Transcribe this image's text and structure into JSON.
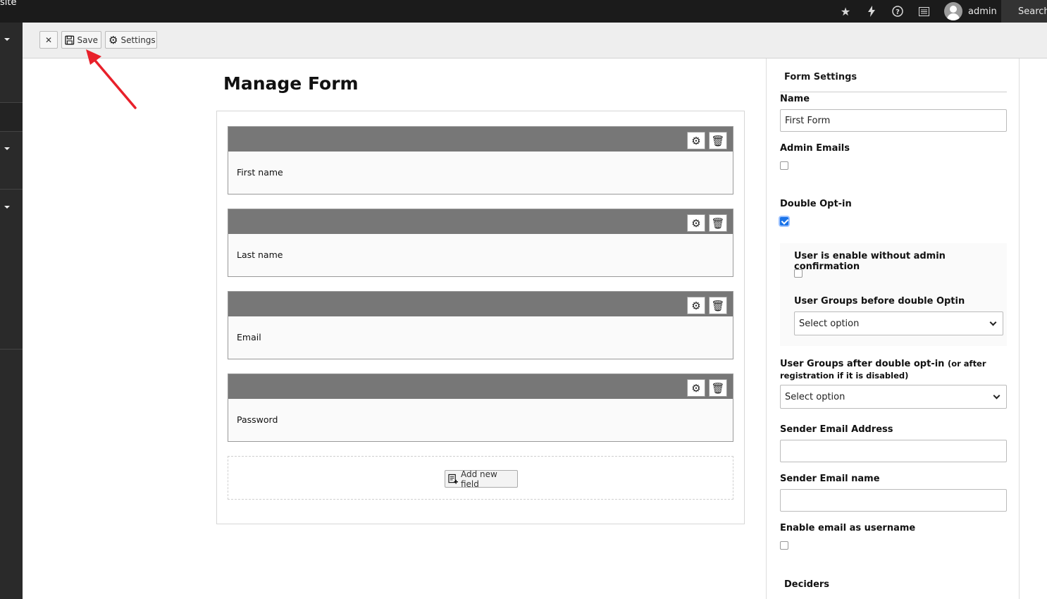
{
  "topbar": {
    "site_label": "site",
    "username": "admin",
    "search_label": "Search",
    "icons": [
      "star-icon",
      "lightning-icon",
      "help-icon",
      "list-icon",
      "user-avatar-icon",
      "search-icon"
    ]
  },
  "toolbar": {
    "close_label": "✕",
    "save_label": "Save",
    "settings_label": "Settings"
  },
  "main": {
    "title": "Manage Form",
    "fields": [
      {
        "label": "First name"
      },
      {
        "label": "Last name"
      },
      {
        "label": "Email"
      },
      {
        "label": "Password"
      }
    ],
    "add_field_label": "Add new field"
  },
  "settings": {
    "title": "Form Settings",
    "name_label": "Name",
    "name_value": "First Form",
    "admin_emails_label": "Admin Emails",
    "admin_emails_checked": false,
    "double_optin_label": "Double Opt-in",
    "double_optin_checked": true,
    "user_enable_label": "User is enable without admin confirmation",
    "user_enable_checked": false,
    "groups_before_label": "User Groups before double Optin",
    "groups_before_value": "Select option",
    "groups_after_label": "User Groups after double opt-in",
    "groups_after_note": "(or after registration if it is disabled)",
    "groups_after_value": "Select option",
    "sender_email_label": "Sender Email Address",
    "sender_email_value": "",
    "sender_name_label": "Sender Email name",
    "sender_name_value": "",
    "email_username_label": "Enable email as username",
    "email_username_checked": false,
    "deciders_label": "Deciders"
  },
  "colors": {
    "topbar_bg": "#1b1b1b",
    "field_header": "#777777",
    "checkbox_checked": "#1a73e8",
    "annotation_arrow": "#e8202a"
  }
}
